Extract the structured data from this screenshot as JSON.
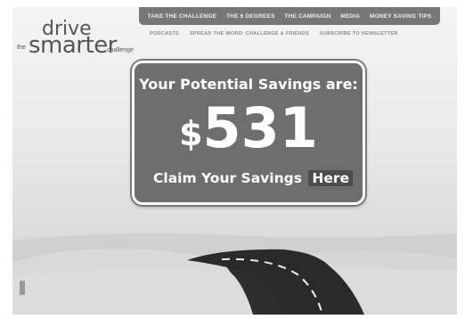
{
  "nav": {
    "top": [
      "TAKE THE CHALLENGE",
      "THE 6 DEGREES",
      "THE CAMPAIGN",
      "MEDIA",
      "MONEY SAVING TIPS"
    ],
    "sub": [
      "PODCASTS",
      "SPREAD THE WORD: CHALLENGE & FRIENDS",
      "SUBSCRIBE TO NEWSLETTER"
    ]
  },
  "logo": {
    "the": "the",
    "drive": "drive",
    "smarter": "smarter",
    "challenge": "challenge"
  },
  "sign": {
    "title": "Your Potential Savings are:",
    "currency": "$",
    "amount": "531",
    "claim_text": "Claim Your Savings",
    "claim_link": "Here"
  },
  "colors": {
    "nav_bg": "#777777",
    "sign_bg": "#6e6e6e",
    "road": "#2e2e2e",
    "sand": "#d4d4d4"
  }
}
